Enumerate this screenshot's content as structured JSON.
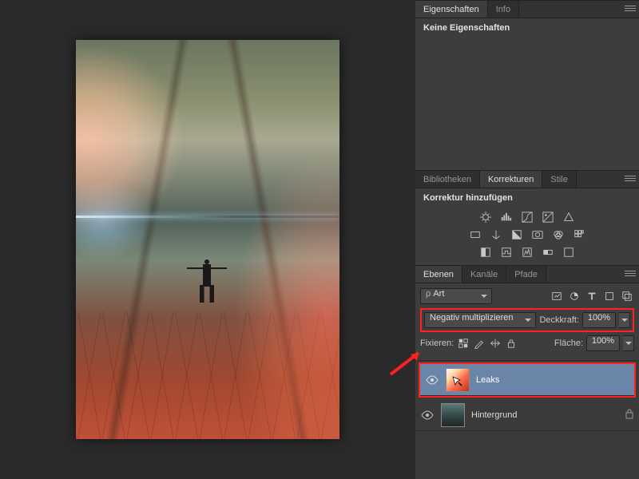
{
  "properties_panel": {
    "tabs": {
      "properties": "Eigenschaften",
      "info": "Info"
    },
    "no_properties": "Keine Eigenschaften"
  },
  "adjustments_panel": {
    "tabs": {
      "libraries": "Bibliotheken",
      "adjustments": "Korrekturen",
      "styles": "Stile"
    },
    "add_adjustment": "Korrektur hinzufügen"
  },
  "layers_panel": {
    "tabs": {
      "layers": "Ebenen",
      "channels": "Kanäle",
      "paths": "Pfade"
    },
    "filter": {
      "label_prefix": "ρ",
      "value": "Art"
    },
    "blend_mode": "Negativ multiplizieren",
    "opacity_label": "Deckkraft:",
    "opacity_value": "100%",
    "lock_label": "Fixieren:",
    "fill_label": "Fläche:",
    "fill_value": "100%",
    "layers": [
      {
        "name": "Leaks",
        "selected": true,
        "locked": false
      },
      {
        "name": "Hintergrund",
        "selected": false,
        "locked": true
      }
    ]
  }
}
